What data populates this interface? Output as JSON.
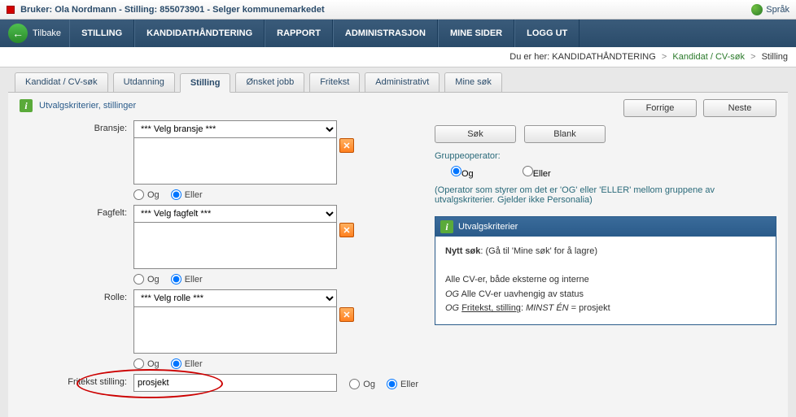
{
  "topbar": {
    "bruker_label": "Bruker:",
    "bruker_name": "Ola Nordmann",
    "stilling_label": "Stilling:",
    "stilling_id": "855073901",
    "stilling_title": "Selger kommunemarkedet",
    "sprak_label": "Språk"
  },
  "navbar": {
    "back_label": "Tilbake",
    "items": [
      "STILLING",
      "KANDIDATHÅNDTERING",
      "RAPPORT",
      "ADMINISTRASJON",
      "MINE SIDER",
      "LOGG UT"
    ]
  },
  "breadcrumb": {
    "prefix": "Du er her:",
    "items": [
      "KANDIDATHÅNDTERING",
      "Kandidat / CV-søk",
      "Stilling"
    ]
  },
  "tabs": {
    "items": [
      "Kandidat / CV-søk",
      "Utdanning",
      "Stilling",
      "Ønsket jobb",
      "Fritekst",
      "Administrativt",
      "Mine søk"
    ],
    "active": 2
  },
  "page": {
    "title": "Utvalgskriterier, stillinger",
    "buttons": {
      "prev": "Forrige",
      "next": "Neste"
    }
  },
  "form": {
    "bransje": {
      "label": "Bransje:",
      "placeholder": "*** Velg bransje ***"
    },
    "fagfelt": {
      "label": "Fagfelt:",
      "placeholder": "*** Velg fagfelt ***"
    },
    "rolle": {
      "label": "Rolle:",
      "placeholder": "*** Velg rolle ***"
    },
    "fritekst": {
      "label": "Fritekst stilling:",
      "value": "prosjekt"
    },
    "radio_og": "Og",
    "radio_eller": "Eller"
  },
  "right": {
    "sok_btn": "Søk",
    "blank_btn": "Blank",
    "group_label": "Gruppeoperator:",
    "group_og": "Og",
    "group_eller": "Eller",
    "hint": "(Operator som styrer om det er 'OG' eller 'ELLER' mellom gruppene av utvalgskriterier. Gjelder ikke Personalia)",
    "panel_title": "Utvalgskriterier",
    "panel_line1a": "Nytt søk",
    "panel_line1b": ": (Gå til 'Mine søk' for å lagre)",
    "panel_line2": "Alle CV-er, både eksterne og interne",
    "panel_line3a": "OG",
    "panel_line3b": " Alle CV-er uavhengig av status",
    "panel_line4a": "OG",
    "panel_line4b_u": "Fritekst, stilling",
    "panel_line4c": ": ",
    "panel_line4d": "MINST ÉN",
    "panel_line4e": " = prosjekt"
  }
}
